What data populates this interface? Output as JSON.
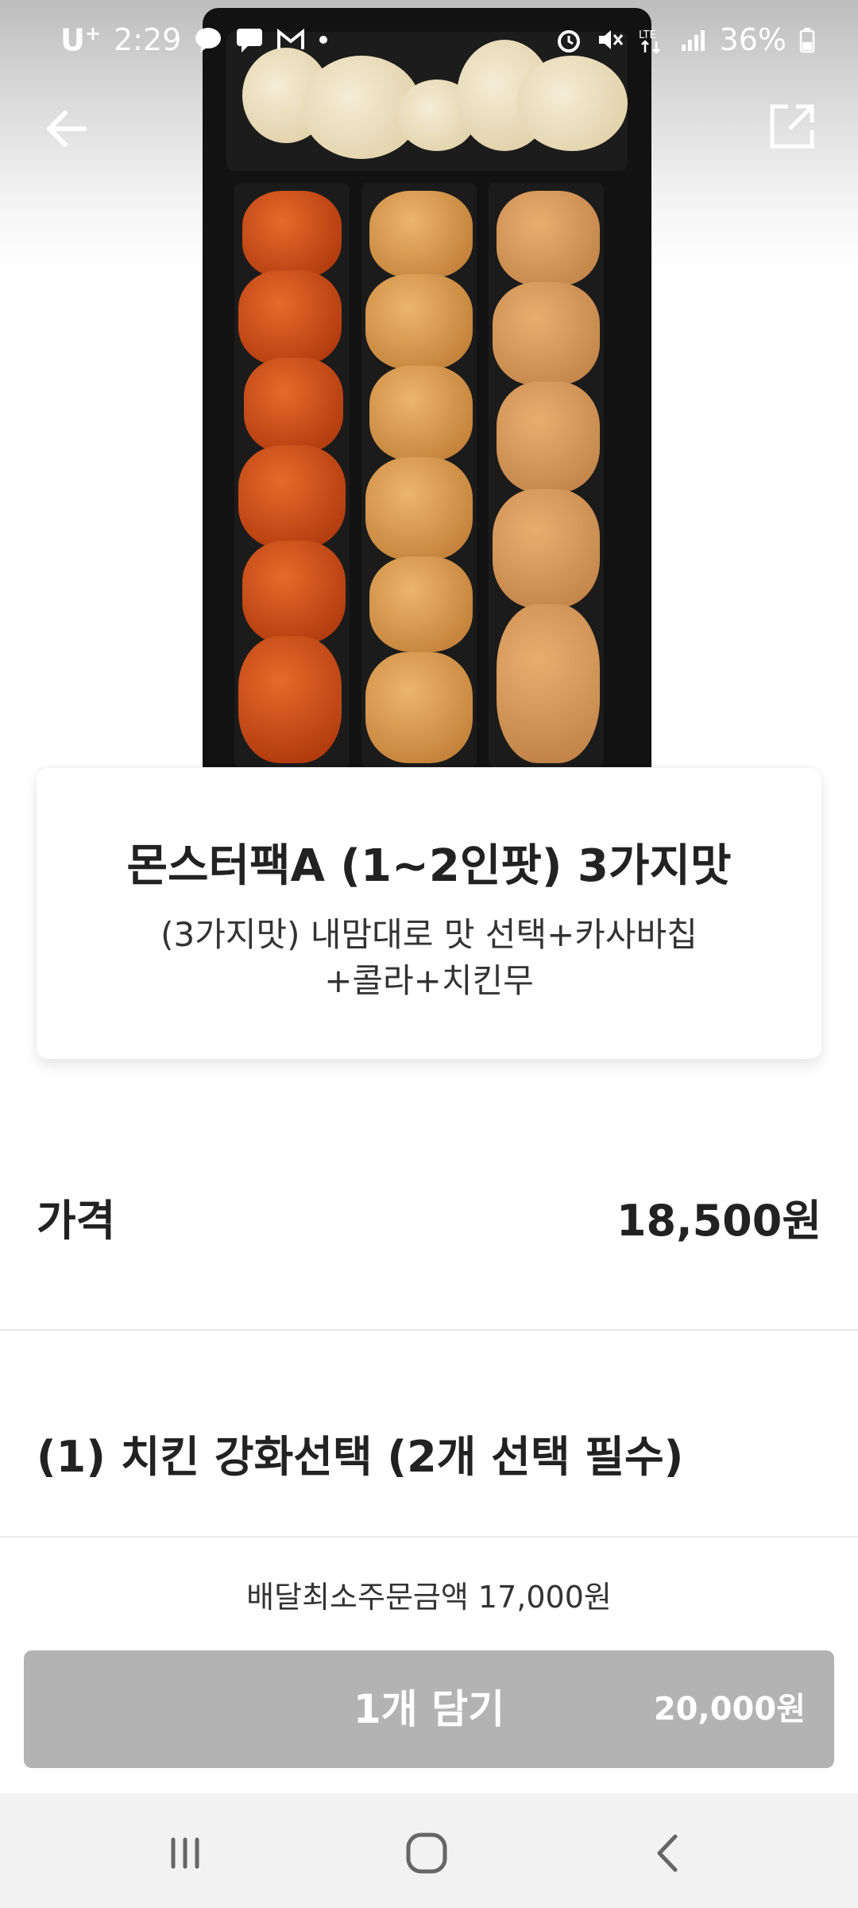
{
  "status_bar": {
    "carrier": "U",
    "carrier_sup": "+",
    "time": "2:29",
    "battery": "36%",
    "icons": [
      "talk-icon",
      "message-icon",
      "gmail-icon",
      "dot-icon",
      "alarm-icon",
      "mute-icon",
      "lte-icon",
      "signal-icon",
      "battery-icon"
    ]
  },
  "header": {
    "back_icon": "arrow-left-icon",
    "share_icon": "share-icon"
  },
  "product": {
    "name": "몬스터팩A (1~2인팟) 3가지맛",
    "description": "(3가지맛) 내맘대로 맛 선택+카사바칩+콜라+치킨무"
  },
  "price": {
    "label": "가격",
    "value": "18,500원"
  },
  "options": {
    "title": "(1) 치킨 강화선택 (2개 선택 필수)"
  },
  "order": {
    "min_order_text": "배달최소주문금액 17,000원",
    "cart_label": "1개 담기",
    "cart_price": "20,000원"
  },
  "nav": {
    "recent_icon": "recent-apps-icon",
    "home_icon": "home-icon",
    "back_icon": "back-chevron-icon"
  },
  "colors": {
    "cart_button": "#b3b3b3",
    "nav_bg": "#f2f2f2"
  }
}
